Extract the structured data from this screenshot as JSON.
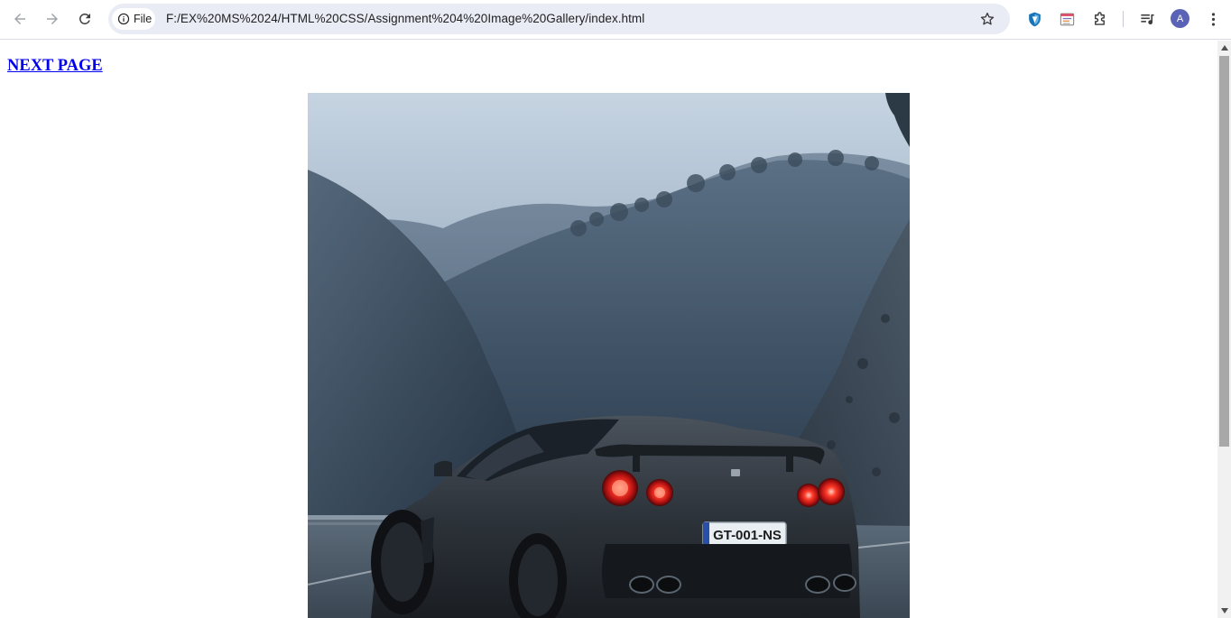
{
  "browser": {
    "icons": {
      "back": "back-arrow-icon",
      "forward": "forward-arrow-icon",
      "reload": "reload-icon",
      "site_info": "info-icon",
      "bookmark": "star-icon",
      "extension_1": "shield-extension-icon",
      "extension_2": "window-extension-icon",
      "extensions_menu": "puzzle-icon",
      "media": "media-control-icon",
      "menu": "kebab-menu-icon"
    },
    "site_chip_label": "File",
    "url": "F:/EX%20MS%2024/HTML%20CSS/Assignment%204%20Image%20Gallery/index.html",
    "profile_initial": "A",
    "colors": {
      "omnibox_bg": "#e9ecf5",
      "avatar_bg": "#5b63b7",
      "shield_blue": "#1a73b8"
    }
  },
  "page": {
    "link_label": "NEXT PAGE",
    "link_color": "#0000ee",
    "image": {
      "subject": "car-photo",
      "license_plate": "GT-001-NS"
    }
  }
}
